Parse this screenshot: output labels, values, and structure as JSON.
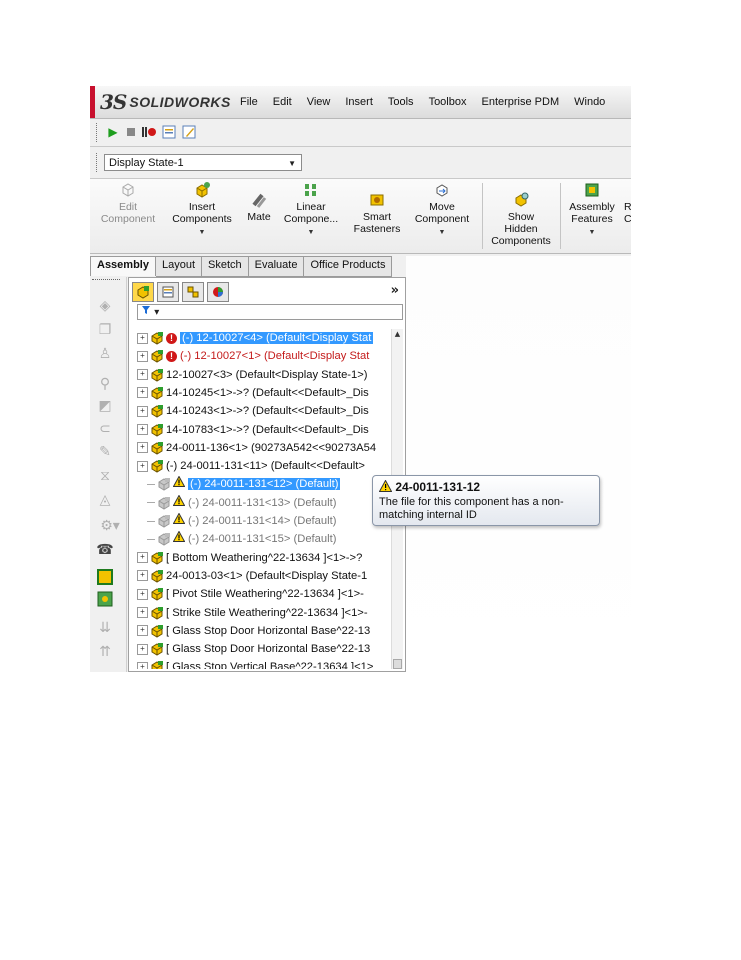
{
  "app": {
    "brand_prefix": "3S",
    "brand_name": "SOLIDWORKS"
  },
  "menu": [
    "File",
    "Edit",
    "View",
    "Insert",
    "Tools",
    "Toolbox",
    "Enterprise PDM",
    "Windo"
  ],
  "display_state": {
    "value": "Display State-1"
  },
  "ribbon": {
    "edit_component": [
      "Edit",
      "Component"
    ],
    "insert_components": [
      "Insert",
      "Components"
    ],
    "mate": "Mate",
    "linear_pattern": [
      "Linear",
      "Compone..."
    ],
    "smart_fasteners": [
      "Smart",
      "Fasteners"
    ],
    "move_component": [
      "Move",
      "Component"
    ],
    "show_hidden": [
      "Show",
      "Hidden",
      "Components"
    ],
    "assembly_features": [
      "Assembly",
      "Features"
    ],
    "cut_left": [
      "R",
      "C"
    ]
  },
  "tabs": [
    "Assembly",
    "Layout",
    "Sketch",
    "Evaluate",
    "Office Products"
  ],
  "panel": {
    "expand_glyph": "»",
    "filter_glyph": "▾"
  },
  "tree": [
    {
      "label": "(-) 12-10027<4> (Default<Display Stat",
      "state": "sel",
      "badge": "!"
    },
    {
      "label": "(-) 12-10027<1> (Default<Display Stat",
      "state": "red",
      "badge": "!"
    },
    {
      "label": "12-10027<3> (Default<Display State-1>)",
      "state": "normal"
    },
    {
      "label": "14-10245<1>->? (Default<<Default>_Dis",
      "state": "normal"
    },
    {
      "label": "14-10243<1>->? (Default<<Default>_Dis",
      "state": "normal"
    },
    {
      "label": "14-10783<1>->? (Default<<Default>_Dis",
      "state": "normal"
    },
    {
      "label": "24-0011-136<1> (90273A542<<90273A54",
      "state": "normal"
    },
    {
      "label": "(-) 24-0011-131<11> (Default<<Default>",
      "state": "normal"
    },
    {
      "label": "(-) 24-0011-131<12> (Default)",
      "state": "selwarn"
    },
    {
      "label": "(-) 24-0011-131<13> (Default)",
      "state": "graywarn"
    },
    {
      "label": "(-) 24-0011-131<14> (Default)",
      "state": "graywarn"
    },
    {
      "label": "(-) 24-0011-131<15> (Default)",
      "state": "graywarn"
    },
    {
      "label": "[ Bottom Weathering^22-13634 ]<1>->?",
      "state": "normal"
    },
    {
      "label": "24-0013-03<1> (Default<Display State-1",
      "state": "normal"
    },
    {
      "label": "[ Pivot Stile Weathering^22-13634 ]<1>-",
      "state": "normal"
    },
    {
      "label": "[ Strike Stile Weathering^22-13634 ]<1>-",
      "state": "normal"
    },
    {
      "label": "[ Glass Stop Door Horizontal Base^22-13",
      "state": "normal"
    },
    {
      "label": "[ Glass Stop Door Horizontal Base^22-13",
      "state": "normal"
    },
    {
      "label": "[ Glass Stop Vertical Base^22-13634 ]<1>",
      "state": "normal"
    }
  ],
  "tooltip": {
    "title": "24-0011-131-12",
    "body": "The file for this component has a non-matching internal ID"
  },
  "colors": {
    "selection": "#3399ff",
    "error_text": "#c41b1b",
    "brand_red": "#c8102e"
  }
}
